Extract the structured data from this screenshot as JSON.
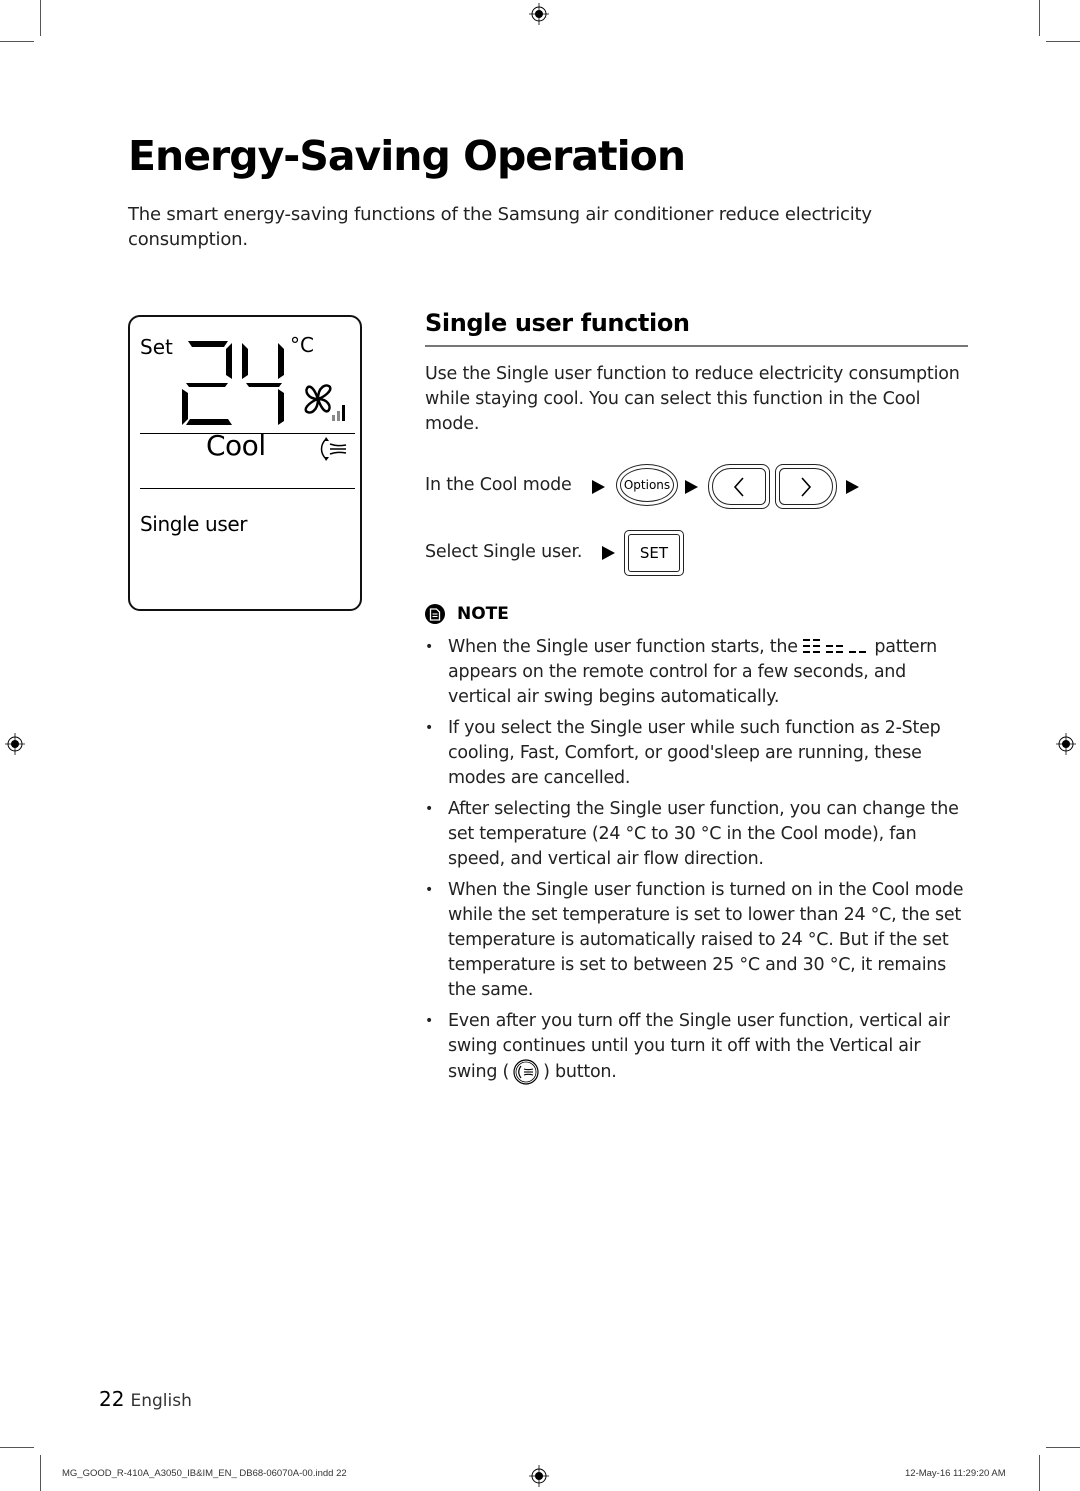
{
  "page": {
    "title": "Energy-Saving Operation",
    "intro": "The smart energy-saving functions of the Samsung air conditioner reduce electricity consumption."
  },
  "display": {
    "set_label": "Set",
    "temperature": "24",
    "unit": "°C",
    "mode": "Cool",
    "function": "Single user",
    "fan_icon": "fan-icon",
    "fan_speed_bars": 3,
    "swing_icon": "vertical-air-swing-icon"
  },
  "section": {
    "title": "Single user function",
    "description": "Use the Single user function to reduce electricity consumption while staying cool. You can select this function in the Cool mode.",
    "steps": [
      {
        "label": "In the Cool mode",
        "buttons": [
          "Options",
          "<",
          ">"
        ]
      },
      {
        "label": "Select Single user.",
        "buttons": [
          "SET"
        ]
      }
    ]
  },
  "note": {
    "label": "NOTE",
    "icon": "note-document-icon",
    "items": [
      {
        "before": "When the Single user function starts, the",
        "after": "pattern appears on the remote control for a few seconds, and vertical air swing begins automatically."
      },
      {
        "text": "If you select the Single user while such function as 2-Step cooling, Fast, Comfort, or good'sleep are running, these modes are cancelled."
      },
      {
        "text": "After selecting the Single user function, you can change the set temperature (24 °C to 30 °C in the Cool mode), fan speed, and vertical air flow direction."
      },
      {
        "text": "When the Single user function is turned on in the Cool mode while the set temperature is set to lower than 24 °C, the set temperature is automatically raised to 24 °C. But if the set temperature is set to between 25 °C and 30 °C, it remains the same."
      },
      {
        "before": "Even after you turn off the Single user function, vertical air swing continues until you turn it off with the Vertical air swing (",
        "after": ") button."
      }
    ]
  },
  "footer": {
    "page_number": "22",
    "language": "English",
    "slug_file": "MG_GOOD_R-410A_A3050_IB&IM_EN_ DB68-06070A-00.indd   22",
    "slug_date": "12-May-16   11:29:20 AM"
  }
}
